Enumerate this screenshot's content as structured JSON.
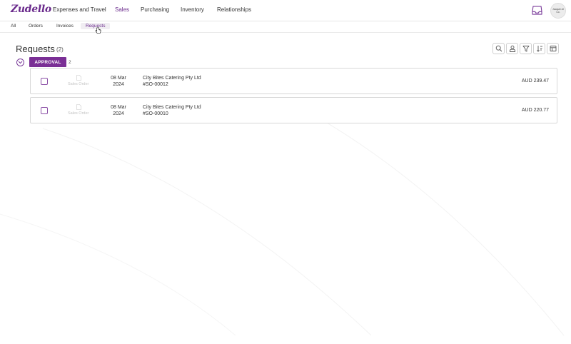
{
  "app": {
    "logo": "Zudello",
    "brand_color": "#6a2a8c"
  },
  "nav": {
    "items": [
      {
        "label": "Expenses and Travel"
      },
      {
        "label": "Sales"
      },
      {
        "label": "Purchasing"
      },
      {
        "label": "Inventory"
      },
      {
        "label": "Relationships"
      }
    ],
    "active": "Sales"
  },
  "header": {
    "inbox_icon": "inbox-icon",
    "avatar_text_line1": "Jacquie AI",
    "avatar_text_line2": "Co."
  },
  "subtabs": {
    "items": [
      {
        "label": "All"
      },
      {
        "label": "Orders"
      },
      {
        "label": "Invoices"
      },
      {
        "label": "Requests"
      }
    ],
    "active": "Requests"
  },
  "page": {
    "title": "Requests",
    "count": "(2)"
  },
  "toolbar": {
    "icons": [
      "search-icon",
      "user-icon",
      "filter-icon",
      "sort-icon",
      "columns-icon"
    ]
  },
  "group": {
    "label": "APPROVAL",
    "count": "2"
  },
  "rows": [
    {
      "doc_type": "Sales Order",
      "date_line1": "08 Mar",
      "date_line2": "2024",
      "party": "City Bites Catering Pty Ltd",
      "doc_number": "#SO-00012",
      "amount": "AUD 239.47"
    },
    {
      "doc_type": "Sales Order",
      "date_line1": "08 Mar",
      "date_line2": "2024",
      "party": "City Bites Catering Pty Ltd",
      "doc_number": "#SO-00010",
      "amount": "AUD 220.77"
    }
  ]
}
